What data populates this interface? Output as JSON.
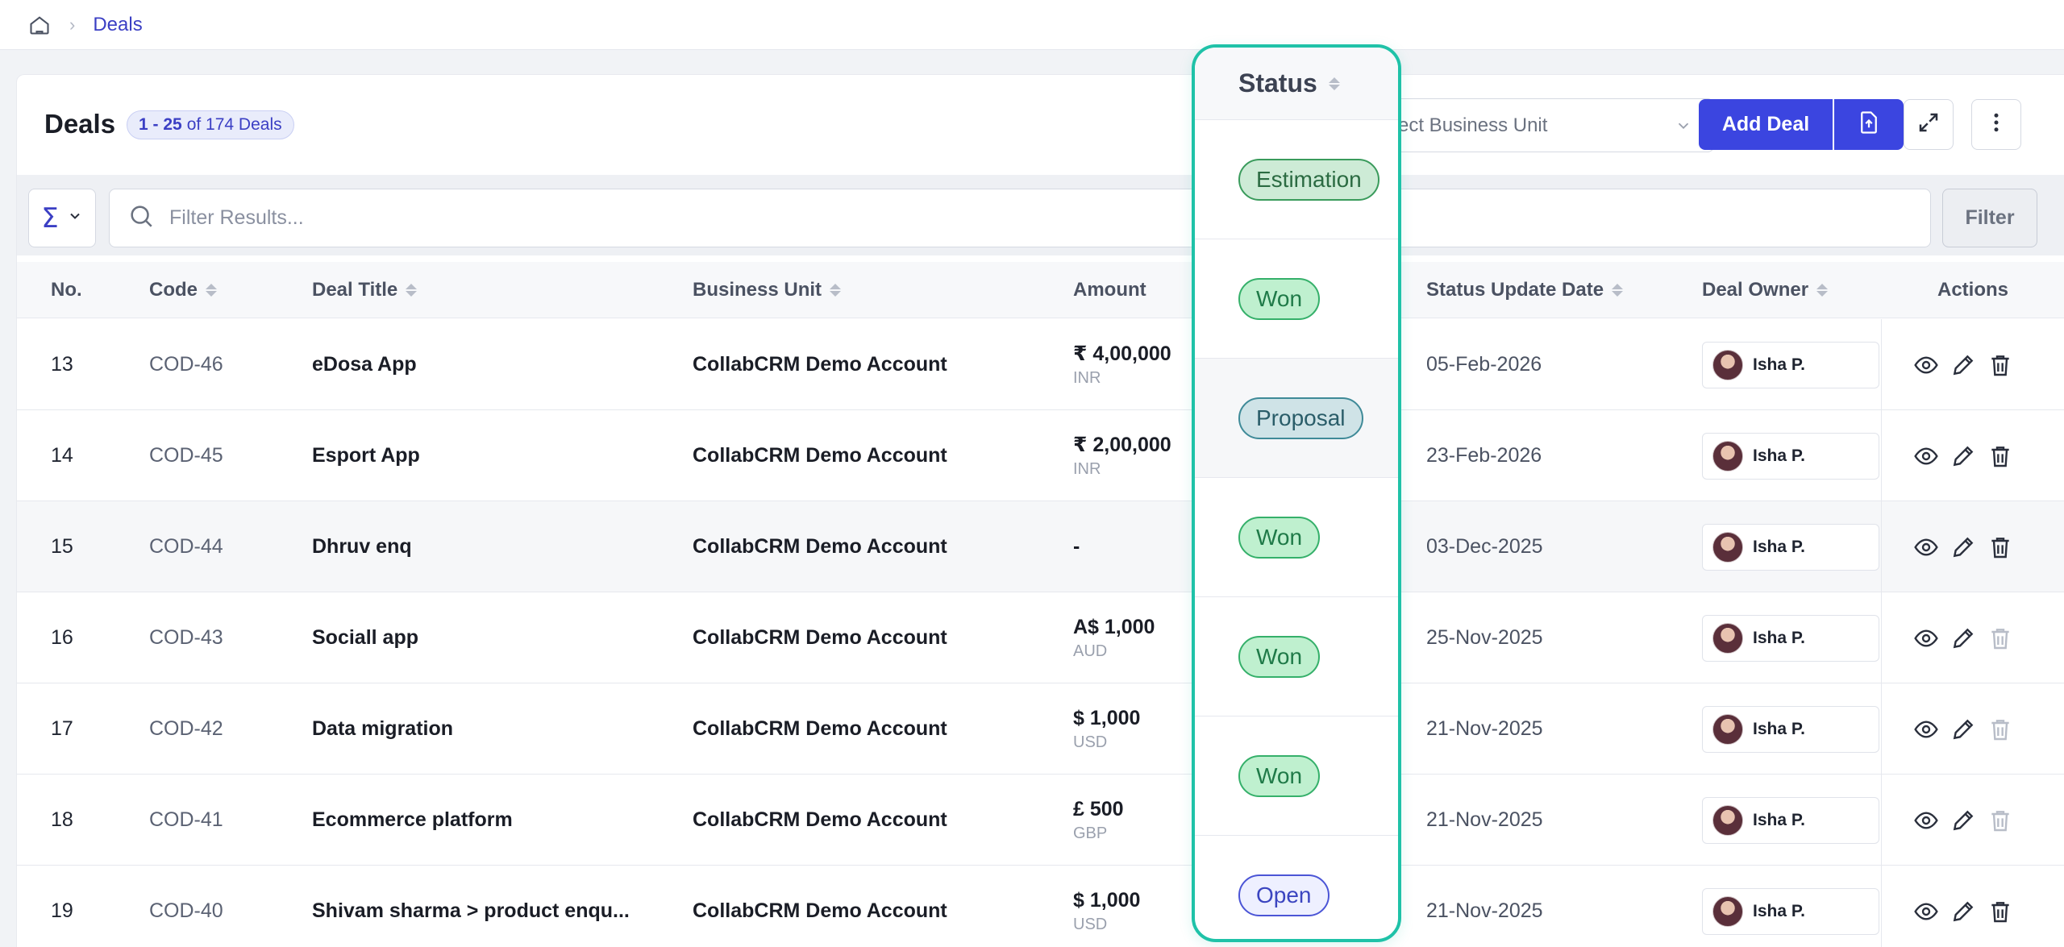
{
  "breadcrumb": {
    "current": "Deals"
  },
  "header": {
    "title": "Deals",
    "count_range": "1 - 25",
    "count_text": "of 174 Deals",
    "business_unit_placeholder": "ect Business Unit",
    "add_deal_label": "Add Deal"
  },
  "filter": {
    "search_placeholder": "Filter Results...",
    "filter_label": "Filter"
  },
  "columns": {
    "no": "No.",
    "code": "Code",
    "title": "Deal Title",
    "business_unit": "Business Unit",
    "amount": "Amount",
    "status": "Status",
    "status_date": "Status Update Date",
    "owner": "Deal Owner",
    "actions": "Actions"
  },
  "rows": [
    {
      "no": "13",
      "code": "COD-46",
      "title": "eDosa App",
      "business_unit": "CollabCRM Demo Account",
      "amount": "₹ 4,00,000",
      "currency": "INR",
      "status": "Estimation",
      "date": "05-Feb-2026",
      "owner": "Isha P."
    },
    {
      "no": "14",
      "code": "COD-45",
      "title": "Esport App",
      "business_unit": "CollabCRM Demo Account",
      "amount": "₹ 2,00,000",
      "currency": "INR",
      "status": "Won",
      "date": "23-Feb-2026",
      "owner": "Isha P."
    },
    {
      "no": "15",
      "code": "COD-44",
      "title": "Dhruv enq",
      "business_unit": "CollabCRM Demo Account",
      "amount": "-",
      "currency": "",
      "status": "Proposal",
      "date": "03-Dec-2025",
      "owner": "Isha P."
    },
    {
      "no": "16",
      "code": "COD-43",
      "title": "Sociall app",
      "business_unit": "CollabCRM Demo Account",
      "amount": "A$ 1,000",
      "currency": "AUD",
      "status": "Won",
      "date": "25-Nov-2025",
      "owner": "Isha P."
    },
    {
      "no": "17",
      "code": "COD-42",
      "title": "Data migration",
      "business_unit": "CollabCRM Demo Account",
      "amount": "$ 1,000",
      "currency": "USD",
      "status": "Won",
      "date": "21-Nov-2025",
      "owner": "Isha P."
    },
    {
      "no": "18",
      "code": "COD-41",
      "title": "Ecommerce platform",
      "business_unit": "CollabCRM Demo Account",
      "amount": "£ 500",
      "currency": "GBP",
      "status": "Won",
      "date": "21-Nov-2025",
      "owner": "Isha P."
    },
    {
      "no": "19",
      "code": "COD-40",
      "title": "Shivam sharma > product enqu...",
      "business_unit": "CollabCRM Demo Account",
      "amount": "$ 1,000",
      "currency": "USD",
      "status": "Open",
      "date": "21-Nov-2025",
      "owner": "Isha P."
    }
  ],
  "colors": {
    "accent": "#3b45e0",
    "highlight_border": "#1fc2a8",
    "won": "#35b06a",
    "open": "#4b55d6"
  }
}
